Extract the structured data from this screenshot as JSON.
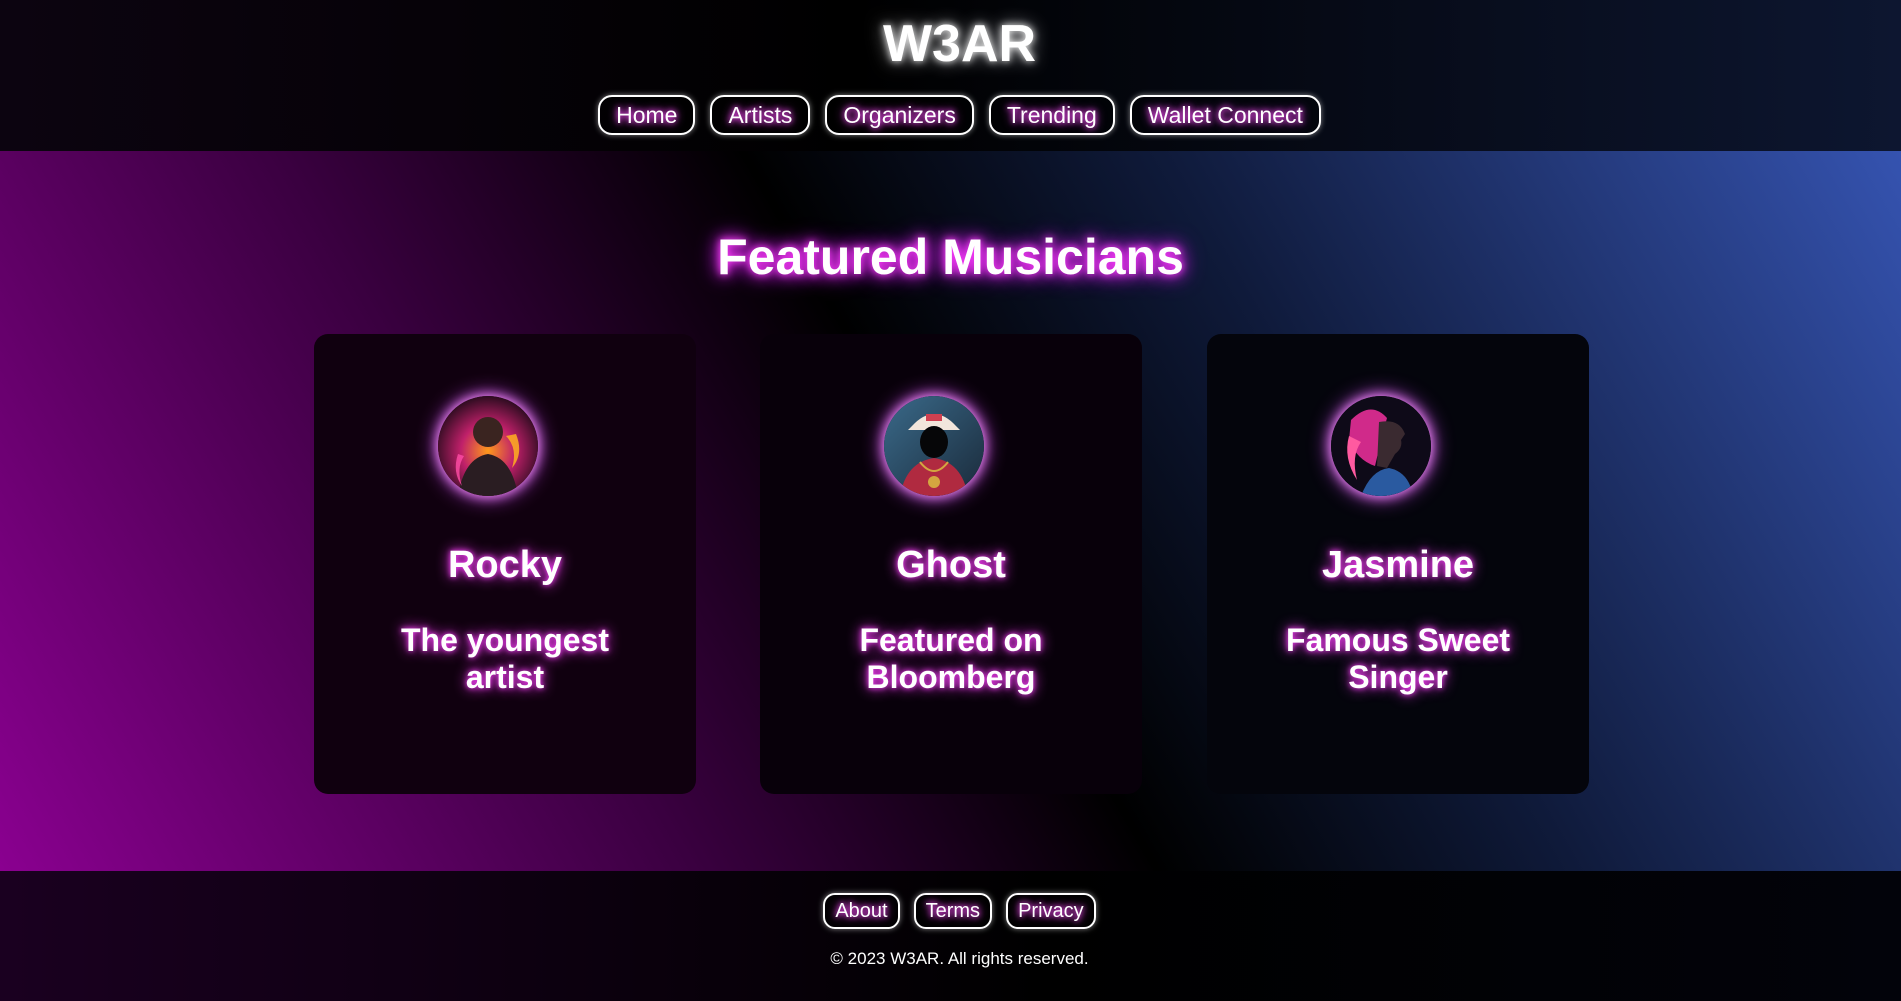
{
  "site": {
    "logo": "W3AR"
  },
  "nav": {
    "items": [
      {
        "label": "Home"
      },
      {
        "label": "Artists"
      },
      {
        "label": "Organizers"
      },
      {
        "label": "Trending"
      },
      {
        "label": "Wallet Connect"
      }
    ]
  },
  "featured": {
    "title": "Featured Musicians",
    "cards": [
      {
        "name": "Rocky",
        "description": "The youngest artist",
        "avatar_icon": "artist-flame-avatar-icon"
      },
      {
        "name": "Ghost",
        "description": "Featured on Bloomberg",
        "avatar_icon": "masked-rapper-avatar-icon"
      },
      {
        "name": "Jasmine",
        "description": "Famous Sweet Singer",
        "avatar_icon": "singer-profile-avatar-icon"
      }
    ]
  },
  "footer": {
    "links": [
      {
        "label": "About"
      },
      {
        "label": "Terms"
      },
      {
        "label": "Privacy"
      }
    ],
    "copyright": "© 2023 W3AR. All rights reserved."
  },
  "colors": {
    "accent_glow": "#ff40ff",
    "gradient_left": "#8a0090",
    "gradient_right": "#3553b0"
  }
}
